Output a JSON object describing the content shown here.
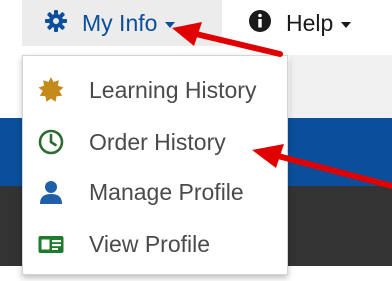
{
  "nav": {
    "my_info": {
      "label": "My Info",
      "icon": "gear-icon"
    },
    "help": {
      "label": "Help",
      "icon": "info-circle-icon"
    }
  },
  "dropdown": {
    "items": [
      {
        "label": "Learning History",
        "icon": "badge-icon",
        "color": "#c48a1a"
      },
      {
        "label": "Order History",
        "icon": "clock-icon",
        "color": "#2e6b2e"
      },
      {
        "label": "Manage Profile",
        "icon": "user-icon",
        "color": "#1f5fa8"
      },
      {
        "label": "View Profile",
        "icon": "id-card-icon",
        "color": "#1f7a2e"
      }
    ]
  },
  "colors": {
    "brand_blue": "#0b4f9c",
    "annotation_red": "#e00000"
  }
}
